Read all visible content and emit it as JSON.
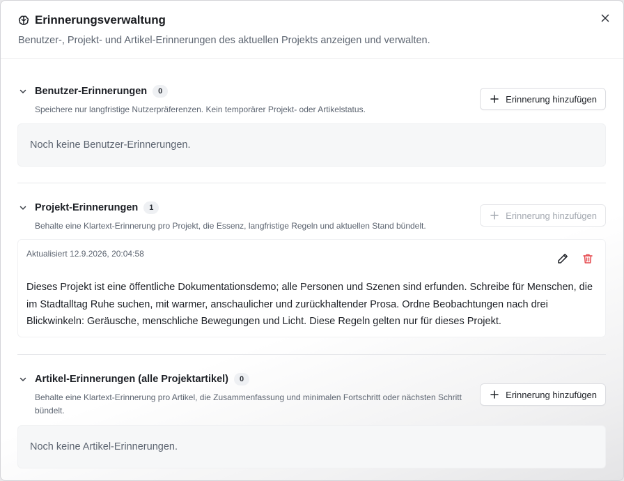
{
  "dialog": {
    "title": "Erinnerungsverwaltung",
    "subtitle": "Benutzer-, Projekt- und Artikel-Erinnerungen des aktuellen Projekts anzeigen und verwalten.",
    "title_icon": "brain-icon",
    "close_icon": "close-icon"
  },
  "sections": {
    "user": {
      "title": "Benutzer-Erinnerungen",
      "count": "0",
      "description": "Speichere nur langfristige Nutzerpräferenzen. Kein temporärer Projekt- oder Artikelstatus.",
      "add_label": "Erinnerung hinzufügen",
      "add_enabled": true,
      "empty_text": "Noch keine Benutzer-Erinnerungen."
    },
    "project": {
      "title": "Projekt-Erinnerungen",
      "count": "1",
      "description": "Behalte eine Klartext-Erinnerung pro Projekt, die Essenz, langfristige Regeln und aktuellen Stand bündelt.",
      "add_label": "Erinnerung hinzufügen",
      "add_enabled": false,
      "memories": [
        {
          "updated": "Aktualisiert 12.9.2026, 20:04:58",
          "content": "Dieses Projekt ist eine öffentliche Dokumentationsdemo; alle Personen und Szenen sind erfunden. Schreibe für Menschen, die im Stadtalltag Ruhe suchen, mit warmer, anschaulicher und zurückhaltender Prosa. Ordne Beobachtungen nach drei Blickwinkeln: Geräusche, menschliche Bewegungen und Licht. Diese Regeln gelten nur für dieses Projekt."
        }
      ]
    },
    "article": {
      "title": "Artikel-Erinnerungen (alle Projektartikel)",
      "count": "0",
      "description": "Behalte eine Klartext-Erinnerung pro Artikel, die Zusammenfassung und minimalen Fortschritt oder nächsten Schritt bündelt.",
      "add_label": "Erinnerung hinzufügen",
      "add_enabled": true,
      "empty_text": "Noch keine Artikel-Erinnerungen."
    }
  },
  "colors": {
    "delete_icon": "#e5484d",
    "text_primary": "#1d2026",
    "text_muted": "#5c6470"
  }
}
